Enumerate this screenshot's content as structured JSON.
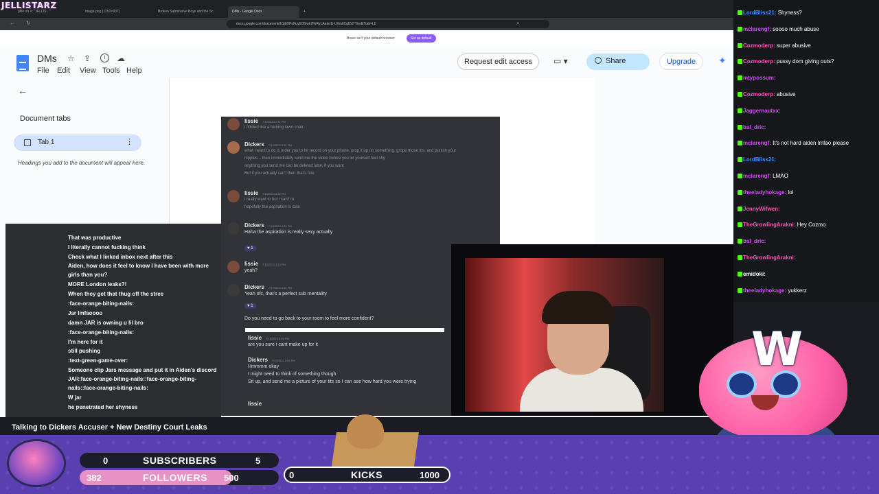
{
  "browser": {
    "brand": "JELLISTARZ",
    "tabs": [
      "pfile on X: \"JELLIS...\"",
      "image.png (1252×937)",
      "Broken Submissive Boys and the Sc",
      "DMs - Google Docs"
    ],
    "url": "docs.google.com/document/d/1jhHPoFuy6O5Iwk7RrRyLAater1i-UXmtlCgf2d7Y/edit?tab=t.0",
    "brave_message": "Brave isn't your default browser",
    "brave_button": "Set as default"
  },
  "docs": {
    "title": "DMs",
    "menu": [
      "File",
      "Edit",
      "View",
      "Tools",
      "Help"
    ],
    "request_edit": "Request edit access",
    "share": "Share",
    "upgrade": "Upgrade",
    "document_tabs": "Document tabs",
    "tab1": "Tab 1",
    "hint": "Headings you add to the document will appear here."
  },
  "discord": {
    "messages": [
      {
        "user": "lissie",
        "time": "7/19/2024 4:31 PM",
        "lines": [
          "i fiddled like a fucking lawn chair"
        ]
      },
      {
        "user": "Dickers",
        "time": "7/19/2024 4:32 PM",
        "lines": [
          "what I want to do is order you to hit record on your phone, prop it up on something, grope those tits, and punish your",
          "nipples... then immediately send me the video before you let yourself feel shy",
          "anything you send me can be deleted later, if you want",
          "But if you actually can't then that's fine"
        ]
      },
      {
        "user": "lissie",
        "time": "7/19/2024 4:32 PM",
        "lines": [
          "i really want to but i can't rn",
          "hopefully the aspiration is cute"
        ]
      },
      {
        "user": "Dickers",
        "time": "7/19/2024 4:33 PM",
        "lines": [
          "Haha the aspiration is really sexy actually"
        ],
        "reaction": "1"
      },
      {
        "user": "lissie",
        "time": "7/19/2024 4:33 PM",
        "lines": [
          "yeah?"
        ]
      },
      {
        "user": "Dickers",
        "time": "7/19/2024 4:34 PM",
        "lines": [
          "Yeah ofc, that's a perfect sub mentality"
        ],
        "reaction": "1"
      },
      {
        "user": "",
        "time": "",
        "lines": [
          "Do you need to go back to your room to feel more confident?"
        ]
      },
      {
        "user": "lissie",
        "time": "7/19/2024 5:03 PM",
        "lines": [
          "are you sure i cant make up for it"
        ]
      },
      {
        "user": "Dickers",
        "time": "7/19/2024 5:04 PM",
        "lines": [
          "Hmmmm okay",
          "I might need to think of something though",
          "Sit up, and send me a picture of your tits so I can see how hard you were trying"
        ]
      },
      {
        "user": "lissie",
        "time": "",
        "lines": []
      }
    ]
  },
  "chat_left": [
    "That was productive",
    "I literally cannot fucking think",
    "Check what I linked inbox next after this",
    "Aiden, how does it feel to know I have been with more",
    "girls than you?",
    "MORE London leaks?!",
    "When they get that thug off the stree",
    ":face-orange-biting-nails:",
    "Jar lmfaoooo",
    "damn JAR is owning u lil bro",
    ":face-orange-biting-nails:",
    "I'm here for it",
    "still pushing",
    ":text-green-game-over:",
    "Someone clip Jars message and put it in Aiden's discord",
    "JAR:face-orange-biting-nails::face-orange-biting-",
    "nails::face-orange-biting-nails:",
    "W jar",
    "he penetrated her shyness"
  ],
  "chat_right": [
    {
      "user": "LordBliss21",
      "msg": "Shyness?",
      "color": "#3b8cff"
    },
    {
      "user": "mclarengf",
      "msg": "soooo much abuse",
      "color": "#d945ff"
    },
    {
      "user": "Cozmoderp",
      "msg": "super abusive",
      "color": "#ff4fb8"
    },
    {
      "user": "Cozmoderp",
      "msg": "pussy dom giving outs?",
      "color": "#ff4fb8"
    },
    {
      "user": "mtypossum",
      "msg": "",
      "color": "#d945ff"
    },
    {
      "user": "Cozmoderp",
      "msg": "abusive",
      "color": "#ff4fb8"
    },
    {
      "user": "Jaggernautxx",
      "msg": "",
      "color": "#d945ff"
    },
    {
      "user": "bal_dric",
      "msg": "",
      "color": "#d945ff"
    },
    {
      "user": "mclarengf",
      "msg": "It's not hard aiden lmfao please",
      "color": "#d945ff"
    },
    {
      "user": "LordBliss21",
      "msg": "",
      "color": "#3b8cff"
    },
    {
      "user": "mclarengf",
      "msg": "LMAO",
      "color": "#d945ff"
    },
    {
      "user": "theeladyhokage",
      "msg": "lol",
      "color": "#d945ff"
    },
    {
      "user": "JennyWifwen",
      "msg": "",
      "color": "#ff4fb8"
    },
    {
      "user": "TheGrowlingArakni",
      "msg": "Hey Cozmo",
      "color": "#ff4fb8"
    },
    {
      "user": "bal_dric",
      "msg": "",
      "color": "#d945ff"
    },
    {
      "user": "TheGrowlingArakni",
      "msg": "",
      "color": "#ff4fb8"
    },
    {
      "user": "emidoki",
      "msg": "",
      "color": "#ffffff"
    },
    {
      "user": "theeladyhokage",
      "msg": "yukkerz",
      "color": "#d945ff"
    }
  ],
  "stream": {
    "title": "Talking to Dickers Accuser + New Destiny Court Leaks",
    "subs_current": "0",
    "subs_label": "SUBSCRIBERS",
    "subs_goal": "5",
    "followers_current": "382",
    "followers_label": "FOLLOWERS",
    "followers_goal": "500",
    "followers_progress": 0.764,
    "kicks_current": "0",
    "kicks_label": "KICKS",
    "kicks_goal": "1000"
  },
  "colors": {
    "banner": "#5a3fb0",
    "pink": "#ff8fd6",
    "kick_green": "#53fc18",
    "docs_blue": "#c2e7ff"
  }
}
